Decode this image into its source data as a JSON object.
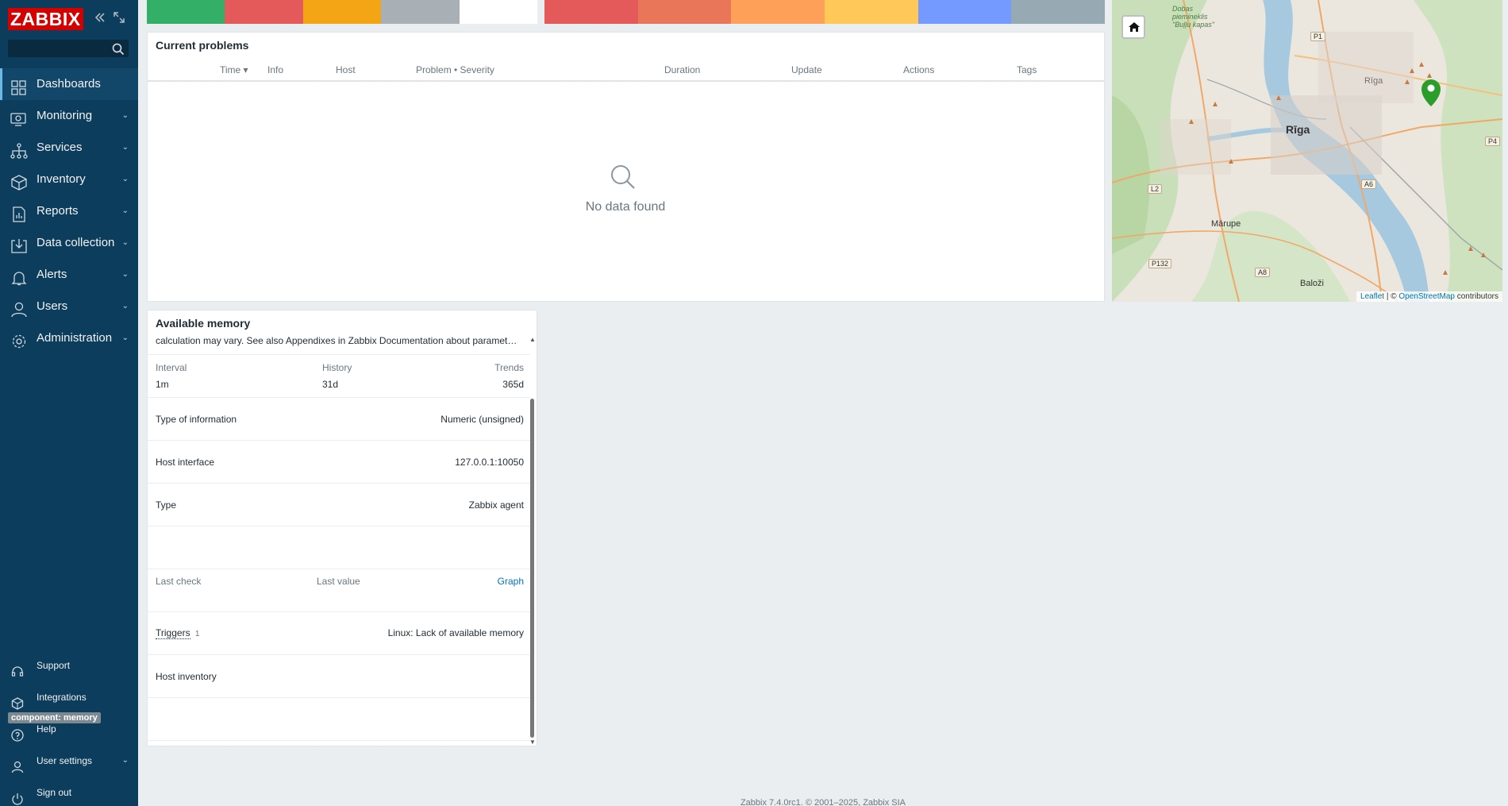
{
  "sidebar": {
    "logo": "ZABBIX",
    "collapse_icon": "double-chevron-left-icon",
    "kiosk_icon": "expand-icon",
    "search": {
      "value": "",
      "placeholder": ""
    },
    "menu": [
      {
        "label": "Dashboards",
        "icon": "dashboard-icon",
        "active": true,
        "has_submenu": false
      },
      {
        "label": "Monitoring",
        "icon": "monitoring-icon",
        "has_submenu": true
      },
      {
        "label": "Services",
        "icon": "services-icon",
        "has_submenu": true
      },
      {
        "label": "Inventory",
        "icon": "inventory-icon",
        "has_submenu": true
      },
      {
        "label": "Reports",
        "icon": "reports-icon",
        "has_submenu": true
      },
      {
        "label": "Data collection",
        "icon": "data-collection-icon",
        "has_submenu": true
      },
      {
        "label": "Alerts",
        "icon": "bell-icon",
        "has_submenu": true
      },
      {
        "label": "Users",
        "icon": "users-icon",
        "has_submenu": true
      },
      {
        "label": "Administration",
        "icon": "gear-icon",
        "has_submenu": true
      }
    ],
    "bottom": [
      {
        "label": "Support",
        "icon": "headset-icon"
      },
      {
        "label": "Integrations",
        "icon": "integrations-icon"
      },
      {
        "label": "Help",
        "icon": "help-icon"
      },
      {
        "label": "User settings",
        "icon": "user-icon",
        "has_submenu": true
      },
      {
        "label": "Sign out",
        "icon": "power-icon"
      }
    ]
  },
  "strips": {
    "left_colors": [
      "#34af67",
      "#e45959",
      "#f3a515",
      "#a8b0b5",
      "#ffffff"
    ],
    "right_colors": [
      "#e45959",
      "#e97659",
      "#ffa059",
      "#ffc859",
      "#7499ff",
      "#97aab3"
    ]
  },
  "problems": {
    "title": "Current problems",
    "columns": [
      "Time ▾",
      "Info",
      "Host",
      "Problem • Severity",
      "Duration",
      "Update",
      "Actions",
      "Tags"
    ],
    "empty_text": "No data found"
  },
  "map": {
    "home_icon": "home-icon",
    "labels": {
      "city": "Rīga",
      "city_small": "Rīga",
      "marupe": "Mārupe",
      "balozi": "Baloži",
      "poi": "Dobas\npiemineklis\n\"Buļļu kapas\""
    },
    "roads": [
      "P1",
      "P4",
      "A6",
      "L2",
      "P132",
      "A8"
    ],
    "marker_color": "#2a9d2a",
    "attribution": {
      "leaflet": "Leaflet",
      "sep": " | © ",
      "osm": "OpenStreetMap",
      "suffix": " contributors"
    }
  },
  "memory": {
    "title": "Available memory",
    "description": "calculation may vary. See also Appendixes in Zabbix Documentation about paramet…",
    "interval_label": "Interval",
    "interval": "1m",
    "history_label": "History",
    "history": "31d",
    "trends_label": "Trends",
    "trends": "365d",
    "type_info_label": "Type of information",
    "type_info": "Numeric (unsigned)",
    "host_interface_label": "Host interface",
    "host_interface": "127.0.0.1:10050",
    "type_label": "Type",
    "type": "Zabbix agent",
    "last_check_label": "Last check",
    "last_value_label": "Last value",
    "graph_link": "Graph",
    "triggers_label": "Triggers",
    "triggers_count": "1",
    "trigger_name": "Linux: Lack of available memory",
    "host_inventory_label": "Host inventory",
    "tag": "component: memory"
  },
  "footer": "Zabbix 7.4.0rc1. © 2001–2025, Zabbix SIA"
}
